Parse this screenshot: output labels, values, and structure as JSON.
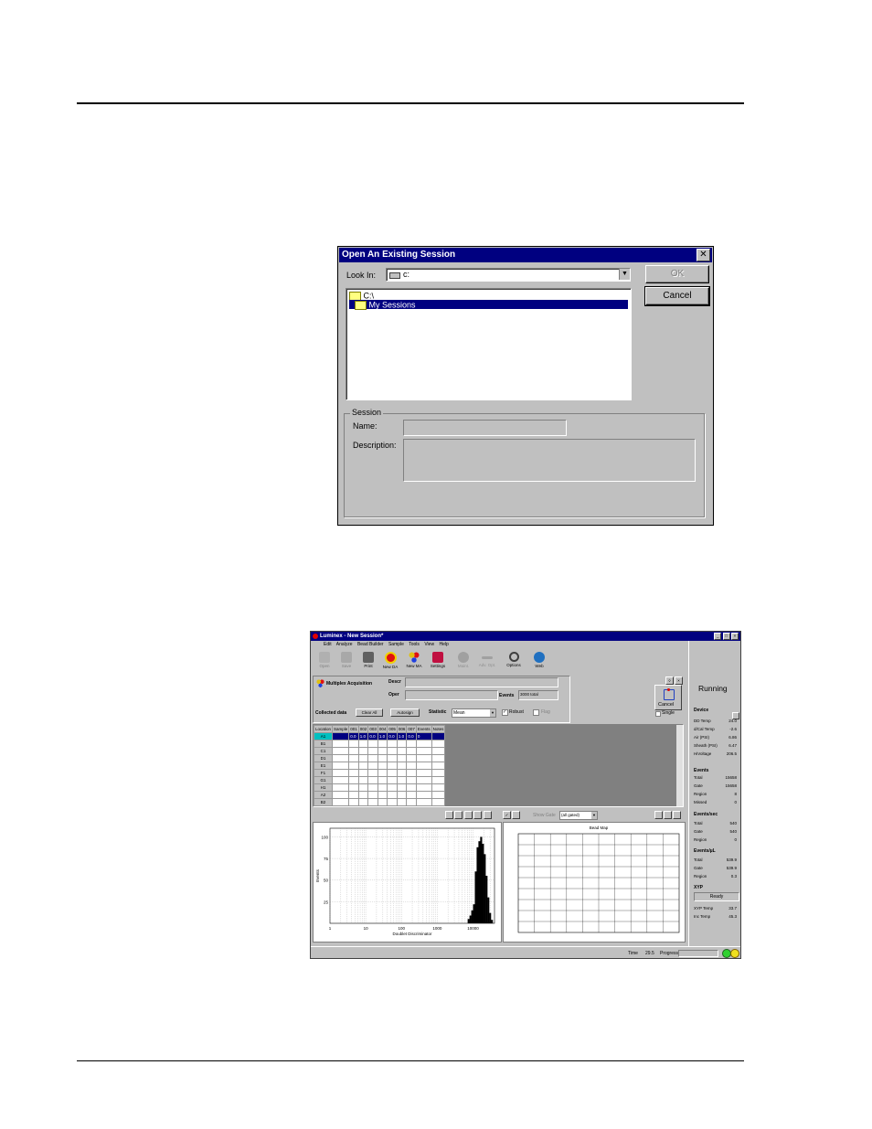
{
  "dialog": {
    "title": "Open An Existing Session",
    "look_in_label": "Look In:",
    "look_in_value": "c:",
    "ok_label": "OK",
    "cancel_label": "Cancel",
    "tree": [
      {
        "label": "C:\\",
        "selected": false
      },
      {
        "label": "My Sessions",
        "selected": true
      }
    ],
    "session_group": "Session",
    "name_label": "Name:",
    "description_label": "Description:"
  },
  "app": {
    "title": "Luminex - New Session*",
    "menu": [
      "Edit",
      "Analyze",
      "Bead Builder",
      "Sample",
      "Tools",
      "View",
      "Help"
    ],
    "toolbar": [
      {
        "label": "Open",
        "icon": "folder-icon",
        "enabled": false,
        "color": "#b0b0b0"
      },
      {
        "label": "Save",
        "icon": "disk-icon",
        "enabled": false,
        "color": "#a8a8a8"
      },
      {
        "label": "Print",
        "icon": "printer-icon",
        "enabled": true,
        "color": "#606060"
      },
      {
        "label": "New DA",
        "icon": "new-da-icon",
        "enabled": true,
        "color": "#e01010"
      },
      {
        "label": "New MA",
        "icon": "new-ma-icon",
        "enabled": true,
        "color": "#e0c010"
      },
      {
        "label": "Settings",
        "icon": "settings-icon",
        "enabled": true,
        "color": "#c01040"
      },
      {
        "label": "Maint.",
        "icon": "gear-icon",
        "enabled": false,
        "color": "#a0a0a0"
      },
      {
        "label": "Adv. Opt.",
        "icon": "tools-icon",
        "enabled": false,
        "color": "#a0a0a0"
      },
      {
        "label": "Options",
        "icon": "magnifier-icon",
        "enabled": true,
        "color": "#404040"
      },
      {
        "label": "Web",
        "icon": "globe-icon",
        "enabled": true,
        "color": "#2070c0"
      }
    ],
    "acq": {
      "title": "Multiplex Acquisition",
      "descr_label": "Descr",
      "oper_label": "Oper",
      "events_label": "Events",
      "events_value": "3000 total",
      "collected_label": "Collected data",
      "clear_all": "Clear All",
      "autosign": "Autosign",
      "statistic_label": "Statistic",
      "statistic_value": "Mean",
      "robust_label": "Robust",
      "flag_label": "Flag"
    },
    "cancel_label": "Cancel",
    "single_label": "Single",
    "grid": {
      "headers": [
        "Location",
        "Sample",
        "001",
        "002",
        "003",
        "004",
        "005",
        "006",
        "007",
        "Events",
        "Notes"
      ],
      "rows": [
        {
          "loc": "A1",
          "cells": [
            "",
            "0.0",
            "1.0",
            "0.0",
            "1.0",
            "0.0",
            "1.0",
            "0.0",
            "0",
            ""
          ],
          "selected": true
        },
        {
          "loc": "B1",
          "cells": [
            "",
            "",
            "",
            "",
            "",
            "",
            "",
            "",
            "",
            ""
          ],
          "selected": false
        },
        {
          "loc": "C1",
          "cells": [
            "",
            "",
            "",
            "",
            "",
            "",
            "",
            "",
            "",
            ""
          ],
          "selected": false
        },
        {
          "loc": "D1",
          "cells": [
            "",
            "",
            "",
            "",
            "",
            "",
            "",
            "",
            "",
            ""
          ],
          "selected": false
        },
        {
          "loc": "E1",
          "cells": [
            "",
            "",
            "",
            "",
            "",
            "",
            "",
            "",
            "",
            ""
          ],
          "selected": false
        },
        {
          "loc": "F1",
          "cells": [
            "",
            "",
            "",
            "",
            "",
            "",
            "",
            "",
            "",
            ""
          ],
          "selected": false
        },
        {
          "loc": "G1",
          "cells": [
            "",
            "",
            "",
            "",
            "",
            "",
            "",
            "",
            "",
            ""
          ],
          "selected": false
        },
        {
          "loc": "H1",
          "cells": [
            "",
            "",
            "",
            "",
            "",
            "",
            "",
            "",
            "",
            ""
          ],
          "selected": false
        },
        {
          "loc": "A2",
          "cells": [
            "",
            "",
            "",
            "",
            "",
            "",
            "",
            "",
            "",
            ""
          ],
          "selected": false
        },
        {
          "loc": "B2",
          "cells": [
            "",
            "",
            "",
            "",
            "",
            "",
            "",
            "",
            "",
            ""
          ],
          "selected": false
        }
      ]
    },
    "status_panel": {
      "state": "Running",
      "device_header": "Device",
      "device": [
        {
          "label": "DD Temp",
          "value": "24.0"
        },
        {
          "label": "d/Cal Temp",
          "value": "-2.6"
        },
        {
          "label": "Air (PSI)",
          "value": "6.86"
        },
        {
          "label": "Sheath (PSI)",
          "value": "6.47"
        },
        {
          "label": "HiVoltage",
          "value": "206.5"
        }
      ],
      "events_header": "Events",
      "events": [
        {
          "label": "Total",
          "value": "15658"
        },
        {
          "label": "Gate",
          "value": "15658"
        },
        {
          "label": "Region",
          "value": "8"
        },
        {
          "label": "Missed",
          "value": "0"
        }
      ],
      "events_sec_header": "Events/sec",
      "events_sec": [
        {
          "label": "Total",
          "value": "540"
        },
        {
          "label": "Gate",
          "value": "540"
        },
        {
          "label": "Region",
          "value": "0"
        }
      ],
      "events_ul_header": "Events/µL",
      "events_ul": [
        {
          "label": "Total",
          "value": "539.9"
        },
        {
          "label": "Gate",
          "value": "539.9"
        },
        {
          "label": "Region",
          "value": "0.3"
        }
      ],
      "xyp_header": "XYP",
      "xyp_state": "Ready",
      "xyp": [
        {
          "label": "XYP Temp",
          "value": "33.7"
        },
        {
          "label": "Inc Temp",
          "value": "45.3"
        }
      ]
    },
    "statusbar": {
      "time_label": "Time",
      "time_value": "29.5",
      "progress_label": "Progress"
    },
    "histogram": {
      "ylabel": "Events",
      "xlabel": "Doublet Discriminator",
      "yticks": [
        "100",
        "75",
        "50",
        "25"
      ],
      "xticks": [
        "1",
        "10",
        "100",
        "1000",
        "10000"
      ],
      "xscale": "log",
      "bins_log10": [
        3.85,
        3.9,
        3.95,
        4.0,
        4.05,
        4.1,
        4.15,
        4.2,
        4.25,
        4.3,
        4.35,
        4.4,
        4.45,
        4.5
      ],
      "counts": [
        5,
        9,
        15,
        22,
        60,
        88,
        95,
        100,
        92,
        80,
        55,
        30,
        12,
        4
      ]
    },
    "dotplot": {
      "title": "Bead Map",
      "gate_select": "(all gated)",
      "show_gate_label": "Show Gate"
    }
  }
}
